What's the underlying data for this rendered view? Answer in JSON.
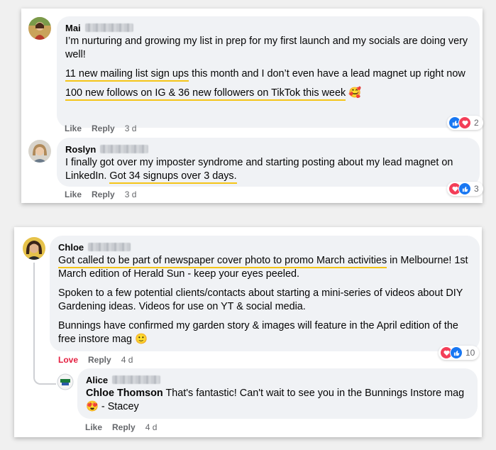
{
  "card1": {
    "comment1": {
      "author": "Mai",
      "paragraphs": {
        "p1": "I’m nurturing and growing my list in prep for my first launch and my socials are doing very well!",
        "p2_hl": "11 new mailing list sign ups",
        "p2_rest": " this month and I don’t even have a lead magnet up right now",
        "p3_hl": "100 new follows on IG & 36 new followers on TikTok this week",
        "p3_emoji": "🥰"
      },
      "actions": {
        "like": "Like",
        "reply": "Reply",
        "time": "3 d"
      },
      "reactions": {
        "count": "2"
      }
    },
    "comment2": {
      "author": "Roslyn",
      "paragraphs": {
        "p1_pre": "I finally got over my imposter syndrome and starting posting about my lead magnet on LinkedIn. ",
        "p1_hl": "Got 34 signups over 3 days."
      },
      "actions": {
        "like": "Like",
        "reply": "Reply",
        "time": "3 d"
      },
      "reactions": {
        "count": "3"
      }
    }
  },
  "card2": {
    "comment1": {
      "author": "Chloe",
      "paragraphs": {
        "p1_hl": "Got called to be part of newspaper cover photo to promo March activities",
        "p1_rest": " in Melbourne! 1st March edition of Herald Sun - keep your eyes peeled.",
        "p2": "Spoken to a few potential clients/contacts about starting a mini-series of videos about DIY Gardening ideas. Videos for use on YT & social media.",
        "p3": "Bunnings have confirmed my garden story & images will feature in the April edition of the free instore mag ",
        "p3_emoji": "🙂"
      },
      "actions": {
        "love": "Love",
        "reply": "Reply",
        "time": "4 d"
      },
      "reactions": {
        "count": "10"
      }
    },
    "reply1": {
      "author": "Alice",
      "mention": "Chloe Thomson",
      "text": " That's fantastic! Can't wait to see you in the Bunnings Instore mag ",
      "emoji": "😍",
      "text_end": " - Stacey",
      "actions": {
        "like": "Like",
        "reply": "Reply",
        "time": "4 d"
      }
    }
  },
  "colors": {
    "like_blue": "#1877f2",
    "love_red": "#f33e58",
    "highlight_yellow": "#f5c518",
    "bubble_bg": "#f0f2f5"
  }
}
